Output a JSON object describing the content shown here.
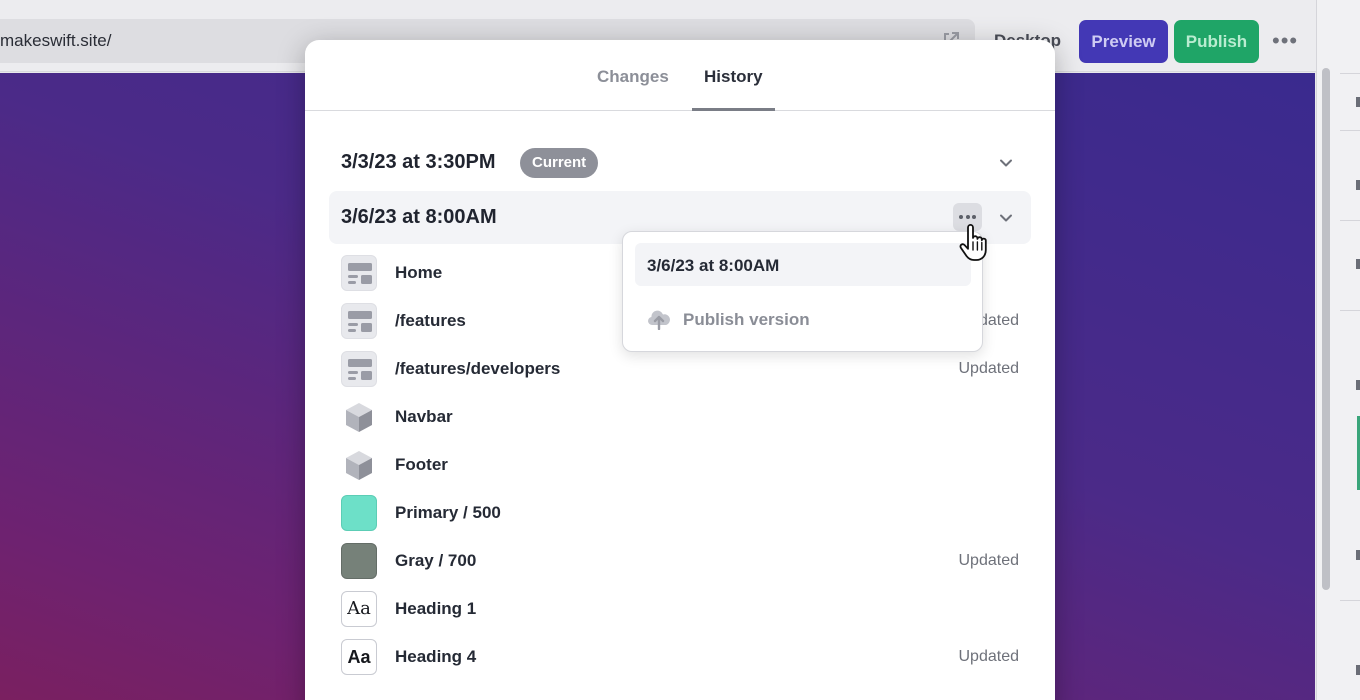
{
  "editor": {
    "url": "makeswift.site/",
    "device_label": "Desktop",
    "preview_label": "Preview",
    "publish_label": "Publish",
    "more_label": "•••"
  },
  "modal": {
    "tabs": [
      {
        "label": "Changes",
        "active": false
      },
      {
        "label": "History",
        "active": true
      }
    ],
    "versions": [
      {
        "date": "3/3/23 at 3:30PM",
        "badge": "Current"
      },
      {
        "date": "3/6/23 at 8:00AM"
      }
    ],
    "items": [
      {
        "label": "Home",
        "icon": "page-layout-icon",
        "status": ""
      },
      {
        "label": "/features",
        "icon": "page-layout-icon",
        "status": "Updated"
      },
      {
        "label": "/features/developers",
        "icon": "page-layout-icon",
        "status": "Updated"
      },
      {
        "label": "Navbar",
        "icon": "cube-icon",
        "status": ""
      },
      {
        "label": "Footer",
        "icon": "cube-icon",
        "status": ""
      },
      {
        "label": "Primary / 500",
        "icon": "color-swatch-icon",
        "color": "#6de0c8",
        "status": ""
      },
      {
        "label": "Gray / 700",
        "icon": "color-swatch-icon",
        "color": "#768179",
        "status": "Updated"
      },
      {
        "label": "Heading 1",
        "icon": "typography-serif-icon",
        "glyph": "Aa",
        "status": ""
      },
      {
        "label": "Heading 4",
        "icon": "typography-sans-icon",
        "glyph": "Aa",
        "status": "Updated"
      }
    ]
  },
  "dropdown": {
    "title": "3/6/23 at 8:00AM",
    "items": [
      {
        "label": "Publish version",
        "icon": "cloud-upload-icon"
      }
    ]
  },
  "colors": {
    "preview_button": "#4338b5",
    "publish_button": "#1fa567",
    "badge": "#8e9099"
  }
}
